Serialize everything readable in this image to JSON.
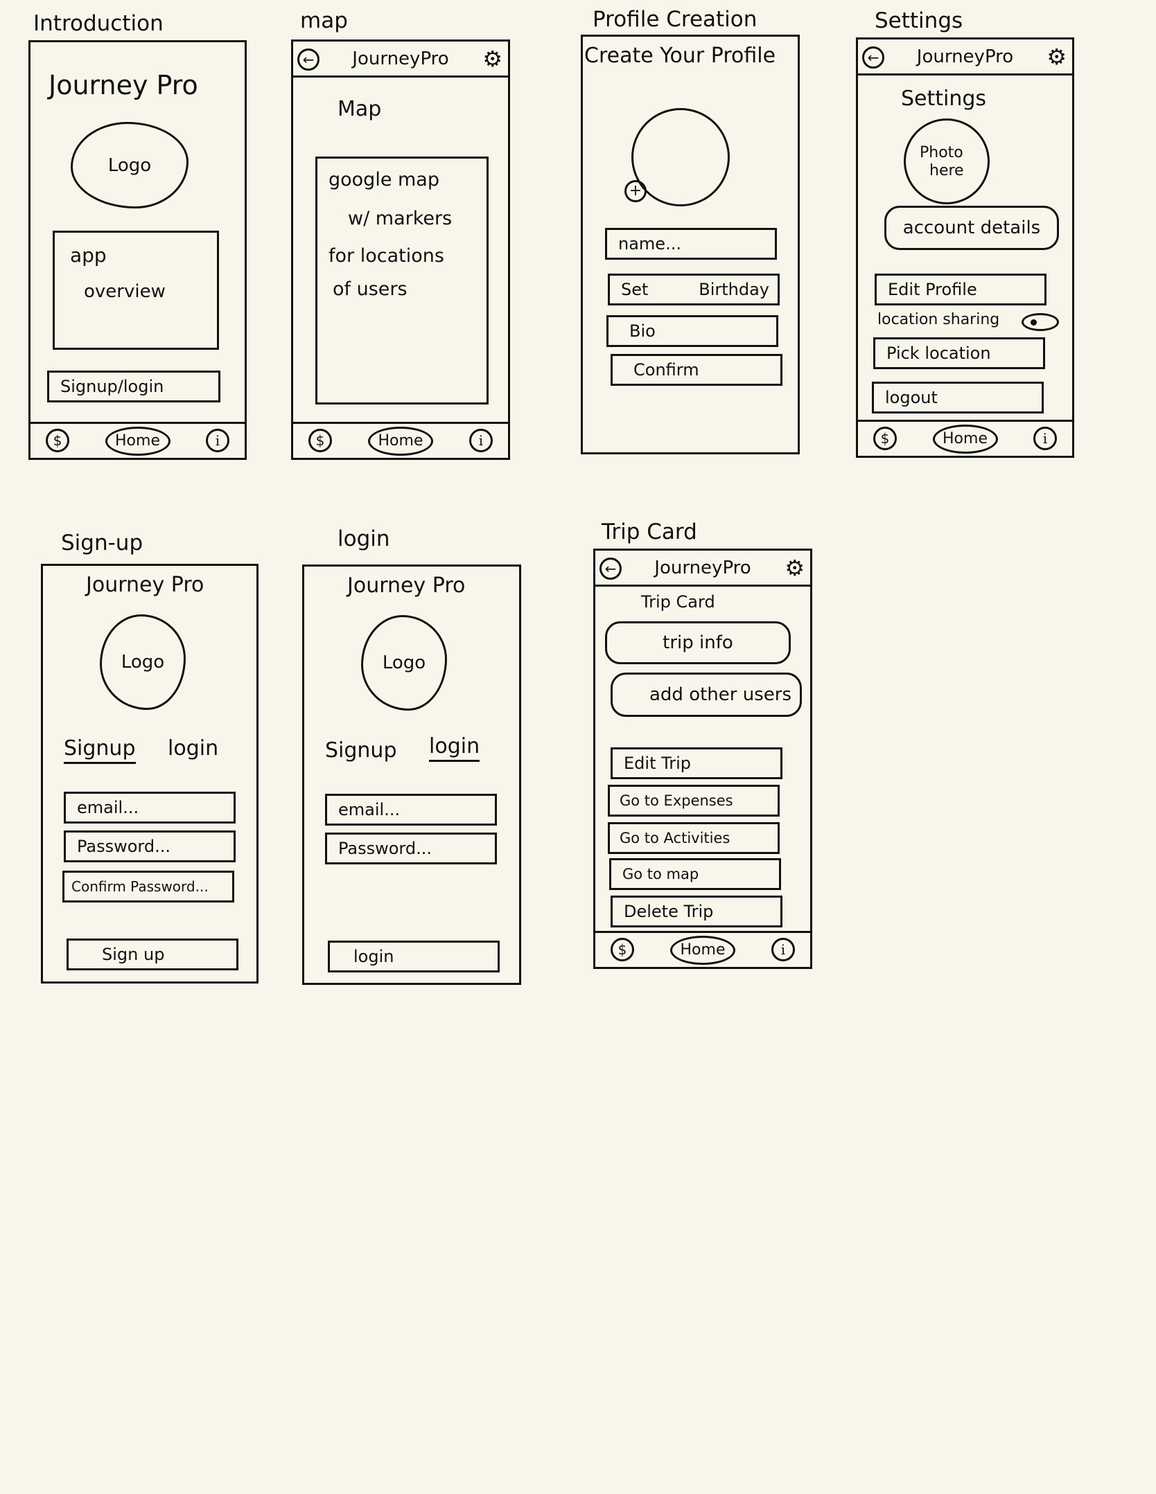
{
  "app_name": "Journey Pro",
  "topbar_title": "JourneyPro",
  "icons": {
    "back": "back-arrow-icon",
    "settings": "gear-icon",
    "currency": "dollar-icon",
    "info": "info-icon"
  },
  "nav": {
    "home": "Home",
    "dollar": "$",
    "info": "i",
    "back": "←",
    "gear": "⚙"
  },
  "screens": {
    "introduction": {
      "frame_title": "Introduction",
      "heading": "Journey Pro",
      "logo": "Logo",
      "overview_line1": "app",
      "overview_line2": "overview",
      "signup_login": "Signup/login"
    },
    "map": {
      "frame_title": "map",
      "heading": "Map",
      "line1": "google map",
      "line2": "w/ markers",
      "line3": "for locations",
      "line4": "of users"
    },
    "profile_creation": {
      "frame_title": "Profile Creation",
      "heading": "Create Your Profile",
      "add_photo": "+",
      "name": "name...",
      "birthday_a": "Set",
      "birthday_b": "Birthday",
      "bio": "Bio",
      "confirm": "Confirm"
    },
    "settings": {
      "frame_title": "Settings",
      "heading": "Settings",
      "photo_line1": "Photo",
      "photo_line2": "here",
      "account_details": "account details",
      "edit_profile": "Edit Profile",
      "location_sharing": "location sharing",
      "pick_location": "Pick location",
      "logout": "logout"
    },
    "signup": {
      "frame_title": "Sign-up",
      "heading": "Journey Pro",
      "logo": "Logo",
      "tab_signup": "Signup",
      "tab_login": "login",
      "email": "email...",
      "password": "Password...",
      "confirm_password": "Confirm Password...",
      "submit": "Sign up"
    },
    "login": {
      "frame_title": "login",
      "heading": "Journey Pro",
      "logo": "Logo",
      "tab_signup": "Signup",
      "tab_login": "login",
      "email": "email...",
      "password": "Password...",
      "submit": "login"
    },
    "trip_card": {
      "frame_title": "Trip Card",
      "heading": "Trip Card",
      "trip_info": "trip info",
      "add_users": "add other users",
      "edit_trip": "Edit Trip",
      "expenses": "Go to Expenses",
      "activities": "Go to Activities",
      "map": "Go to map",
      "delete": "Delete Trip"
    }
  }
}
